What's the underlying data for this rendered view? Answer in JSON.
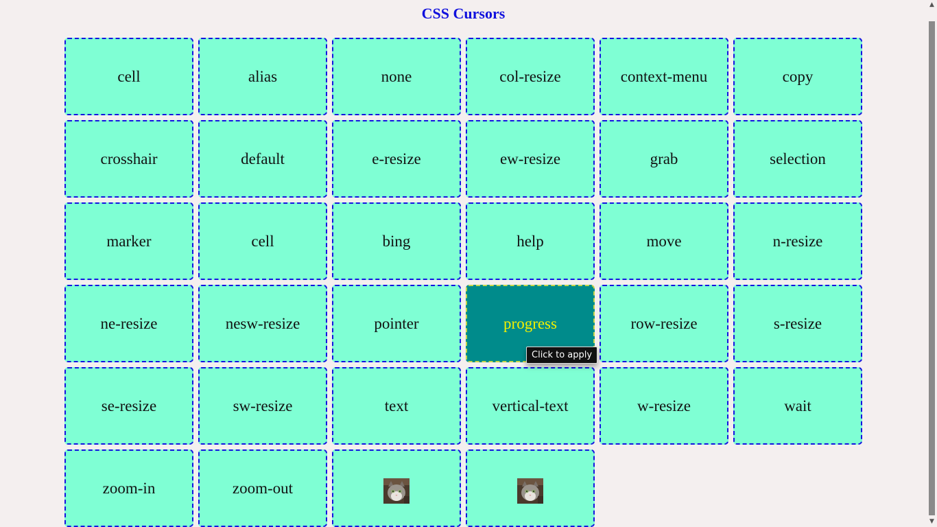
{
  "page": {
    "title": "CSS Cursors"
  },
  "grid": {
    "cells": [
      {
        "label": "cell"
      },
      {
        "label": "alias"
      },
      {
        "label": "none"
      },
      {
        "label": "col-resize"
      },
      {
        "label": "context-menu"
      },
      {
        "label": "copy"
      },
      {
        "label": "crosshair"
      },
      {
        "label": "default"
      },
      {
        "label": "e-resize"
      },
      {
        "label": "ew-resize"
      },
      {
        "label": "grab"
      },
      {
        "label": "selection"
      },
      {
        "label": "marker"
      },
      {
        "label": "cell"
      },
      {
        "label": "bing"
      },
      {
        "label": "help"
      },
      {
        "label": "move"
      },
      {
        "label": "n-resize"
      },
      {
        "label": "ne-resize"
      },
      {
        "label": "nesw-resize"
      },
      {
        "label": "pointer"
      },
      {
        "label": "progress"
      },
      {
        "label": "row-resize"
      },
      {
        "label": "s-resize"
      },
      {
        "label": "se-resize"
      },
      {
        "label": "sw-resize"
      },
      {
        "label": "text"
      },
      {
        "label": "vertical-text"
      },
      {
        "label": "w-resize"
      },
      {
        "label": "wait"
      },
      {
        "label": "zoom-in"
      },
      {
        "label": "zoom-out"
      },
      {
        "label": "",
        "icon": "cat-image-icon"
      },
      {
        "label": "",
        "icon": "cat-image-icon"
      }
    ],
    "active_label": "progress"
  },
  "tooltip": {
    "text": "Click to apply"
  },
  "scrollbar": {
    "up_arrow": "▲",
    "down_arrow": "▼"
  },
  "colors": {
    "background": "#f4efef",
    "title": "#1010dd",
    "cell_background": "#7fffd4",
    "cell_border": "#1414e0",
    "active_background": "#008b8b",
    "active_text": "#f4f100"
  }
}
